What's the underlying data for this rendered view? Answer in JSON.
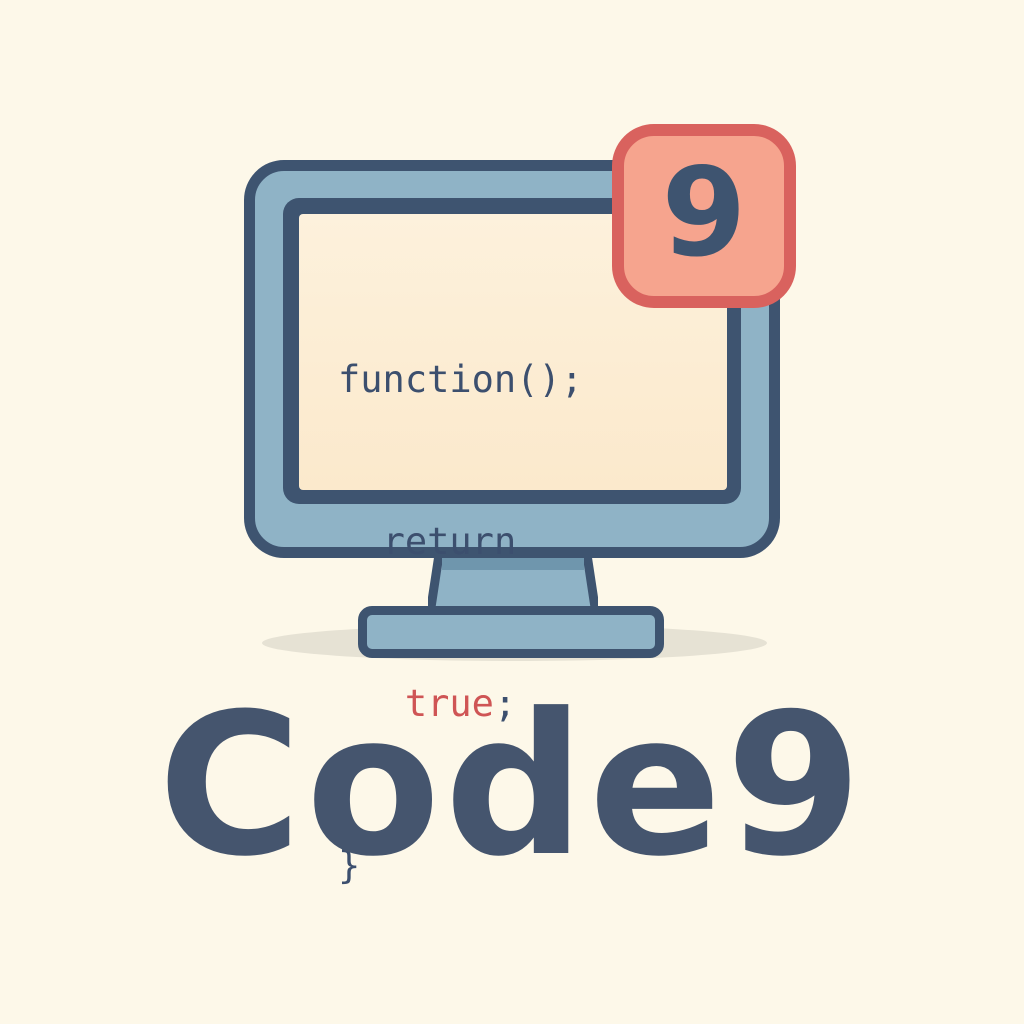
{
  "logo": {
    "badge_number": "9",
    "brand_name": "Code9",
    "code_lines": {
      "line1": "function();",
      "line2_indent": "  ",
      "line2": "return",
      "line3_indent": "   ",
      "line3_keyword": "true",
      "line3_suffix": ";",
      "line4": "}"
    }
  },
  "colors": {
    "background": "#fdf8e9",
    "outline": "#3e5470",
    "monitor_fill": "#8fb3c6",
    "screen_fill": "#fdf1dc",
    "code_text": "#3c4f6e",
    "keyword_true": "#cf5555",
    "badge_fill": "#f6a48e",
    "badge_border": "#d9625e",
    "brand_text": "#45556e"
  },
  "icons": [
    "monitor-icon",
    "notification-badge-icon"
  ]
}
